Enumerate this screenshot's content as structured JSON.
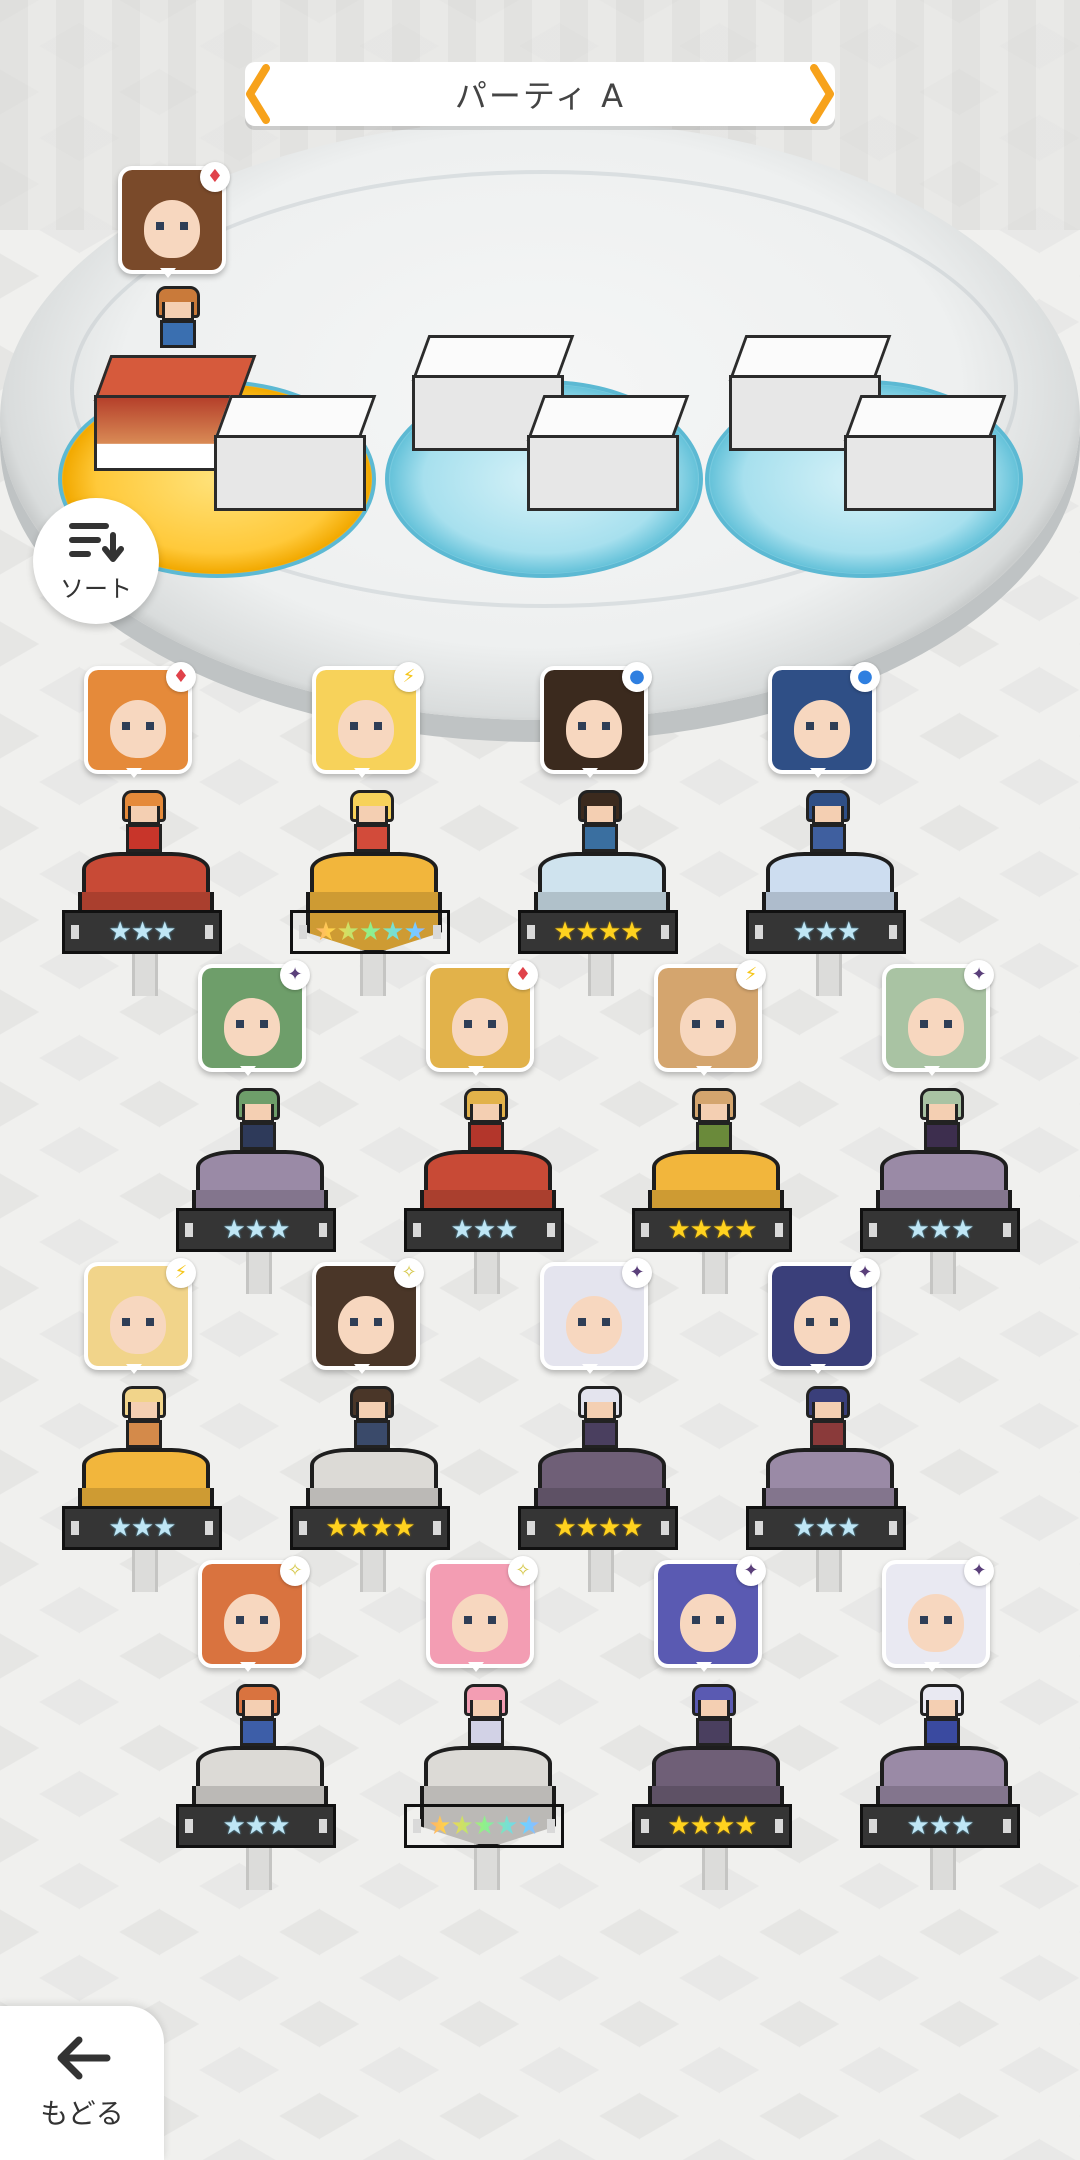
{
  "party": {
    "title": "パーティ A",
    "prev_icon": "chevron-left-icon",
    "next_icon": "chevron-right-icon",
    "accent": "#f7a21b"
  },
  "leader": {
    "element": "fire",
    "badge": "♦"
  },
  "sort_button": {
    "label": "ソート",
    "icon": "sort-icon"
  },
  "back_button": {
    "label": "もどる",
    "icon": "arrow-left-icon"
  },
  "element_colors": {
    "fire": "#e0424a",
    "light": "#f5c518",
    "water": "#2f7fe0",
    "dark": "#5a3f7a",
    "wind": "#d6c84a"
  },
  "characters": [
    {
      "id": "c1",
      "element": "fire",
      "badge": "♦",
      "stars": "★★★",
      "stars_count": 3,
      "hair": "#e58a3a",
      "body": "#c8352a",
      "ped": "#c84a36"
    },
    {
      "id": "c2",
      "element": "light",
      "badge": "⚡",
      "stars": "★★★★★",
      "stars_count": 5,
      "hair": "#f7d25a",
      "body": "#d24b3a",
      "ped": "#f2b63c"
    },
    {
      "id": "c3",
      "element": "water",
      "badge": "●",
      "stars": "★★★★",
      "stars_count": 4,
      "hair": "#3b2a1e",
      "body": "#3a6fa0",
      "ped": "#cfe3ee"
    },
    {
      "id": "c4",
      "element": "water",
      "badge": "●",
      "stars": "★★★",
      "stars_count": 3,
      "hair": "#2f4f86",
      "body": "#3f5f9f",
      "ped": "#cdddf0"
    },
    {
      "id": "c5",
      "element": "dark",
      "badge": "✦",
      "stars": "★★★",
      "stars_count": 3,
      "hair": "#6e9e6a",
      "body": "#2e3a5a",
      "ped": "#9a8aa6"
    },
    {
      "id": "c6",
      "element": "fire",
      "badge": "♦",
      "stars": "★★★",
      "stars_count": 3,
      "hair": "#e2b24a",
      "body": "#b3362b",
      "ped": "#c84a36"
    },
    {
      "id": "c7",
      "element": "light",
      "badge": "⚡",
      "stars": "★★★★",
      "stars_count": 4,
      "hair": "#d4a56e",
      "body": "#6a8a3a",
      "ped": "#f2b63c"
    },
    {
      "id": "c8",
      "element": "dark",
      "badge": "✦",
      "stars": "★★★",
      "stars_count": 3,
      "hair": "#a9c3a3",
      "body": "#3d2e4e",
      "ped": "#9a8aa6"
    },
    {
      "id": "c9",
      "element": "light",
      "badge": "⚡",
      "stars": "★★★",
      "stars_count": 3,
      "hair": "#f1d48a",
      "body": "#d48a4a",
      "ped": "#f2b63c"
    },
    {
      "id": "c10",
      "element": "wind",
      "badge": "✧",
      "stars": "★★★★",
      "stars_count": 4,
      "hair": "#4a3628",
      "body": "#3a4a6a",
      "ped": "#dcdad6"
    },
    {
      "id": "c11",
      "element": "dark",
      "badge": "✦",
      "stars": "★★★★",
      "stars_count": 4,
      "hair": "#e4e4ee",
      "body": "#4a3f5f",
      "ped": "#6f5f77"
    },
    {
      "id": "c12",
      "element": "dark",
      "badge": "✦",
      "stars": "★★★",
      "stars_count": 3,
      "hair": "#3a3f7a",
      "body": "#8a3a3a",
      "ped": "#9a8aa6"
    },
    {
      "id": "c13",
      "element": "wind",
      "badge": "✧",
      "stars": "★★★",
      "stars_count": 3,
      "hair": "#d9733f",
      "body": "#3d5ea8",
      "ped": "#dcdad6"
    },
    {
      "id": "c14",
      "element": "wind",
      "badge": "✧",
      "stars": "★★★★★",
      "stars_count": 5,
      "hair": "#f39db3",
      "body": "#d2d2e6",
      "ped": "#dcdad6"
    },
    {
      "id": "c15",
      "element": "dark",
      "badge": "✦",
      "stars": "★★★★",
      "stars_count": 4,
      "hair": "#5a5ab2",
      "body": "#4a3f5f",
      "ped": "#6f5f77"
    },
    {
      "id": "c16",
      "element": "dark",
      "badge": "✦",
      "stars": "★★★",
      "stars_count": 3,
      "hair": "#e9e9f2",
      "body": "#3a4aa0",
      "ped": "#9a8aa6"
    }
  ]
}
